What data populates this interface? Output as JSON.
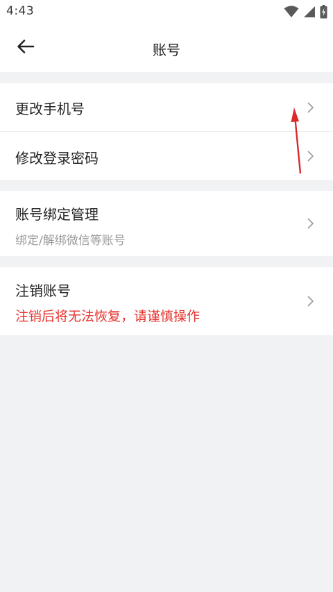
{
  "status_bar": {
    "time": "4:43",
    "icons": [
      "wifi-icon",
      "signal-icon",
      "battery-charging-icon"
    ]
  },
  "header": {
    "title": "账号",
    "back_icon": "arrow-left-icon"
  },
  "groups": [
    {
      "items": [
        {
          "title": "更改手机号"
        },
        {
          "title": "修改登录密码"
        }
      ]
    },
    {
      "items": [
        {
          "title": "账号绑定管理",
          "subtitle": "绑定/解绑微信等账号"
        }
      ]
    },
    {
      "items": [
        {
          "title": "注销账号",
          "subtitle": "注销后将无法恢复，请谨慎操作"
        }
      ]
    }
  ],
  "colors": {
    "background": "#f1f2f4",
    "danger_text": "#e5322d",
    "annotation_arrow": "#d92b2b",
    "chevron": "#9a9a9a"
  }
}
